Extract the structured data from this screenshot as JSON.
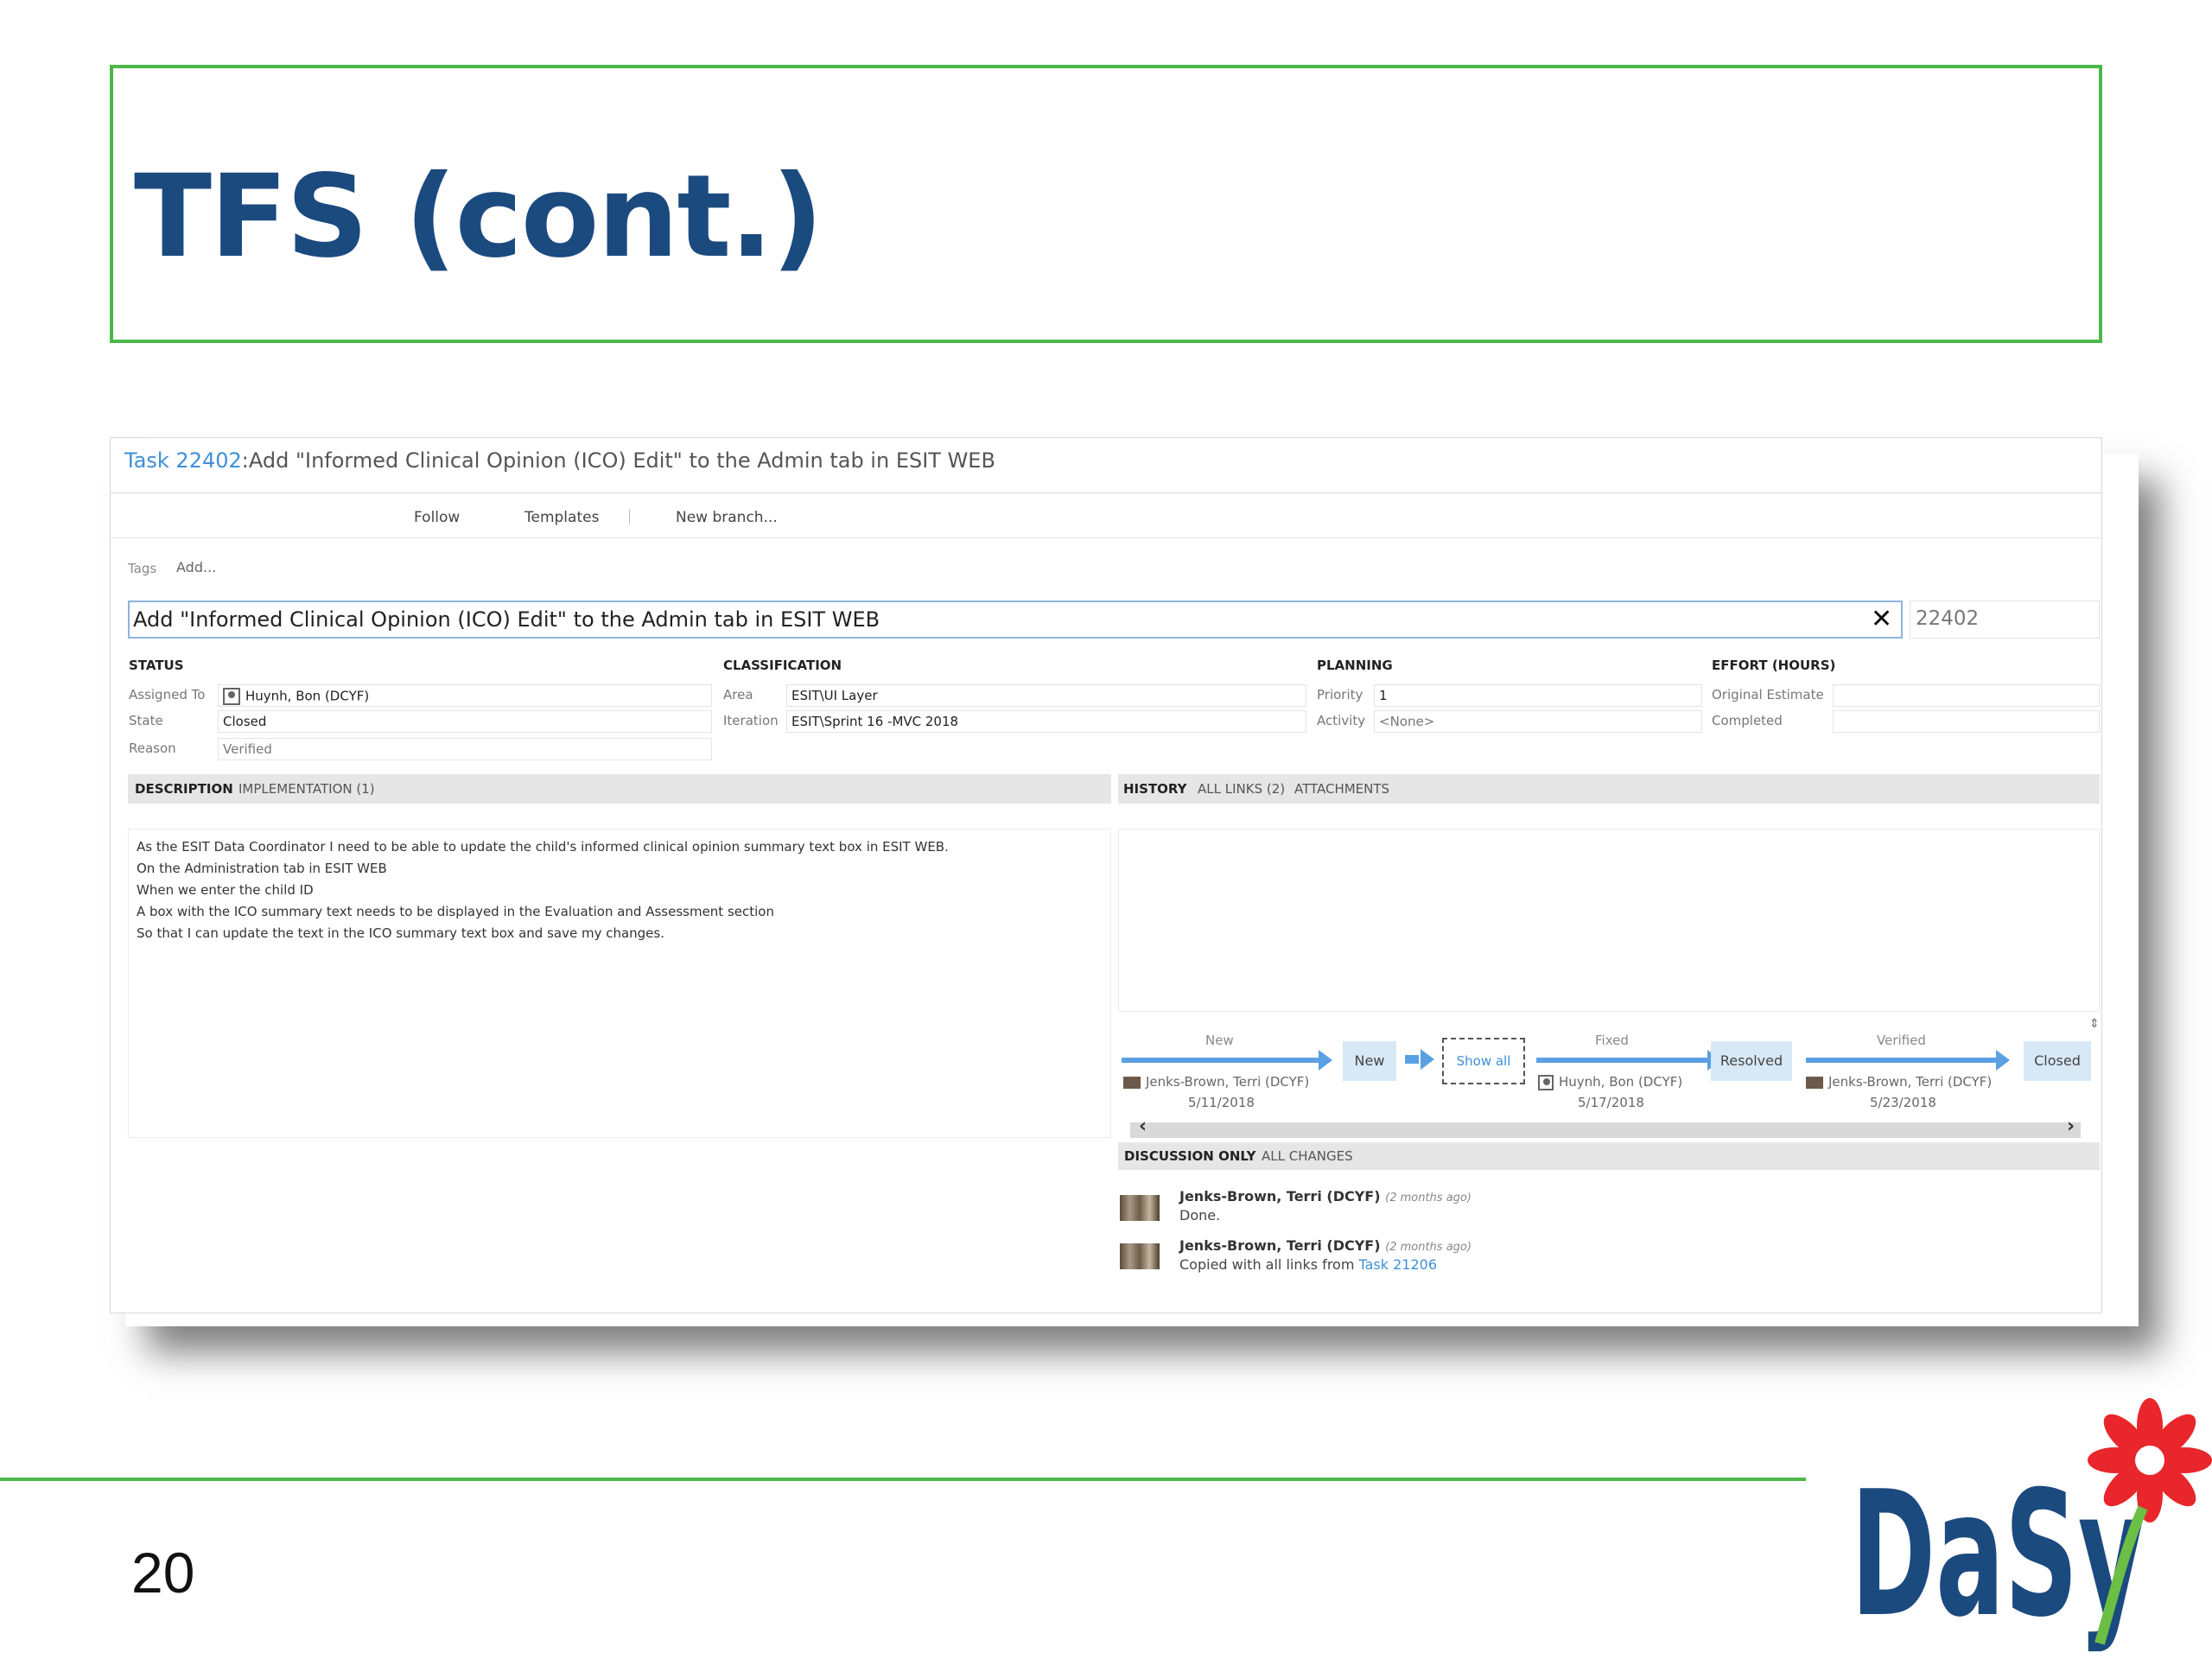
{
  "slide": {
    "title": "TFS (cont.)",
    "page_number": "20"
  },
  "task": {
    "link_text": "Task 22402",
    "title_suffix": ":Add \"Informed Clinical Opinion (ICO) Edit\" to the Admin tab in ESIT WEB",
    "toolbar": [
      "Follow",
      "Templates",
      "New branch..."
    ],
    "tags_label": "Tags",
    "tags_add": "Add...",
    "title_value": "Add \"Informed Clinical Opinion (ICO) Edit\" to the Admin tab in ESIT WEB",
    "id_value": "22402"
  },
  "status": {
    "heading": "STATUS",
    "assigned_label": "Assigned To",
    "assigned_value": "Huynh, Bon (DCYF)",
    "state_label": "State",
    "state_value": "Closed",
    "reason_label": "Reason",
    "reason_value": "Verified"
  },
  "classification": {
    "heading": "CLASSIFICATION",
    "area_label": "Area",
    "area_value": "ESIT\\UI Layer",
    "iteration_label": "Iteration",
    "iteration_value": "ESIT\\Sprint 16 -MVC 2018"
  },
  "planning": {
    "heading": "PLANNING",
    "priority_label": "Priority",
    "priority_value": "1",
    "activity_label": "Activity",
    "activity_value": "<None>"
  },
  "effort": {
    "heading": "EFFORT (HOURS)",
    "original_label": "Original Estimate",
    "completed_label": "Completed"
  },
  "left_tabs": [
    "DESCRIPTION",
    "IMPLEMENTATION (1)"
  ],
  "right_tabs": [
    "HISTORY",
    "ALL LINKS (2)",
    "ATTACHMENTS"
  ],
  "description": [
    "As the ESIT Data Coordinator I need to be able to update the child's informed clinical opinion summary text box in ESIT WEB.",
    "On the Administration tab in ESIT WEB",
    "When we enter the child ID",
    "A box with the ICO summary text needs to be displayed in the Evaluation and Assessment section",
    "So that I can update the text in the ICO summary text box and save my changes."
  ],
  "workflow": {
    "steps": [
      {
        "transition": "New",
        "person": "Jenks-Brown, Terri (DCYF)",
        "date": "5/11/2018",
        "state": "New"
      },
      {
        "transition": "Fixed",
        "person": "Huynh, Bon (DCYF)",
        "date": "5/17/2018",
        "state": "Resolved"
      },
      {
        "transition": "Verified",
        "person": "Jenks-Brown, Terri (DCYF)",
        "date": "5/23/2018",
        "state": "Closed"
      }
    ],
    "show_all": "Show all"
  },
  "discussion": {
    "tabs": [
      "DISCUSSION ONLY",
      "ALL CHANGES"
    ],
    "comments": [
      {
        "author": "Jenks-Brown, Terri (DCYF)",
        "time": "(2 months ago)",
        "text": "Done."
      },
      {
        "author": "Jenks-Brown, Terri (DCYF)",
        "time": "(2 months ago)",
        "text": "Copied with all links from ",
        "link": "Task 21206"
      }
    ]
  },
  "logo": {
    "text": "DaSy",
    "colors": {
      "text": "#1b4a7f",
      "flower": "#e8262b",
      "leaf": "#6cbf45"
    }
  }
}
